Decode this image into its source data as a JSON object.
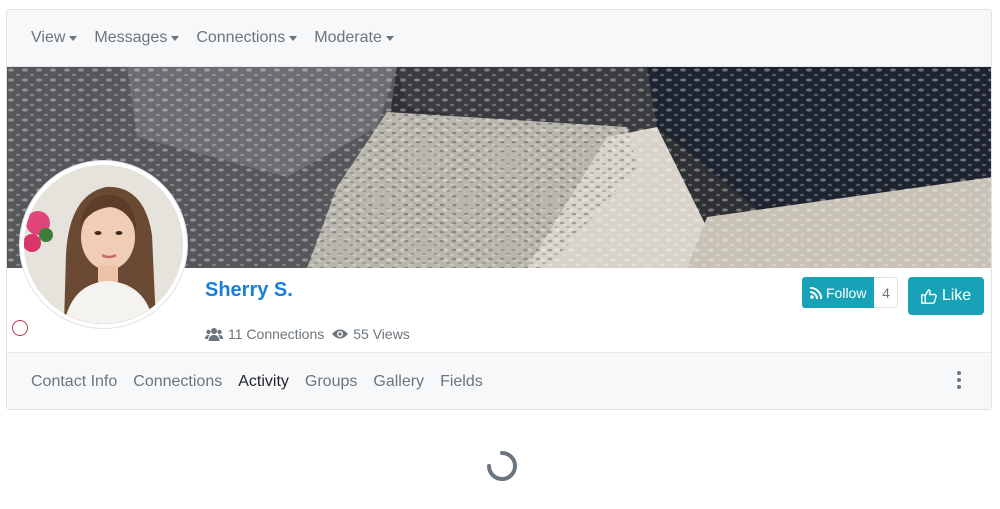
{
  "topnav": {
    "items": [
      {
        "label": "View"
      },
      {
        "label": "Messages"
      },
      {
        "label": "Connections"
      },
      {
        "label": "Moderate"
      }
    ]
  },
  "profile": {
    "name": "Sherry S.",
    "status": "offline",
    "status_color": "#c0334d",
    "connections_count": "11 Connections",
    "views_count": "55 Views"
  },
  "actions": {
    "follow_label": "Follow",
    "follow_count": "4",
    "like_label": "Like",
    "accent_color": "#17a2b8"
  },
  "subnav": {
    "tabs": [
      {
        "label": "Contact Info",
        "active": false
      },
      {
        "label": "Connections",
        "active": false
      },
      {
        "label": "Activity",
        "active": true
      },
      {
        "label": "Groups",
        "active": false
      },
      {
        "label": "Gallery",
        "active": false
      },
      {
        "label": "Fields",
        "active": false
      }
    ]
  },
  "icons": {
    "users": "users-icon",
    "eye": "eye-icon",
    "rss": "rss-icon",
    "thumbs_up": "thumbs-up-icon",
    "menu": "more-vertical-icon",
    "loading": "spinner-icon"
  }
}
